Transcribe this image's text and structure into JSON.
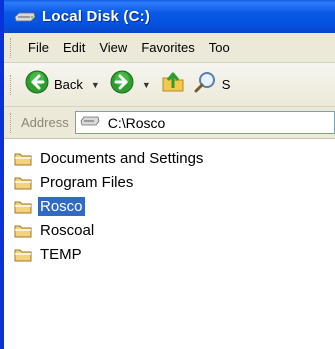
{
  "window": {
    "title": "Local Disk (C:)"
  },
  "menu": {
    "items": [
      "File",
      "Edit",
      "View",
      "Favorites",
      "Too"
    ]
  },
  "toolbar": {
    "back_label": "Back",
    "search_partial": "S"
  },
  "address": {
    "label": "Address",
    "path": "C:\\Rosco"
  },
  "folders": [
    {
      "name": "Documents and Settings",
      "selected": false
    },
    {
      "name": "Program Files",
      "selected": false
    },
    {
      "name": "Rosco",
      "selected": true
    },
    {
      "name": "Roscoal",
      "selected": false
    },
    {
      "name": "TEMP",
      "selected": false
    }
  ],
  "colors": {
    "titlebar": "#0858e6",
    "selection": "#316ac5",
    "chrome": "#ece9d8"
  }
}
